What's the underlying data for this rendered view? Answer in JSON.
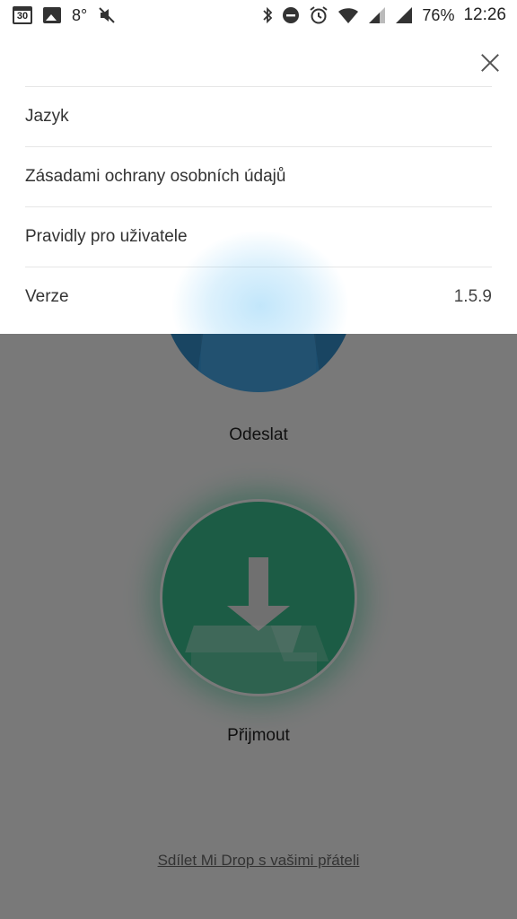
{
  "status_bar": {
    "calendar_day": "30",
    "temperature": "8°",
    "battery": "76%",
    "time": "12:26"
  },
  "settings_panel": {
    "items": [
      {
        "label": "Jazyk"
      },
      {
        "label": "Zásadami ochrany osobních údajů"
      },
      {
        "label": "Pravidly pro uživatele"
      },
      {
        "label": "Verze",
        "value": "1.5.9"
      }
    ]
  },
  "main": {
    "send_label": "Odeslat",
    "receive_label": "Přijmout",
    "share_link": "Sdílet Mi Drop s vašimi přáteli"
  },
  "colors": {
    "send_button": "#3a9ee0",
    "receive_button": "#39b98a",
    "overlay": "rgba(0,0,0,0.5)"
  }
}
